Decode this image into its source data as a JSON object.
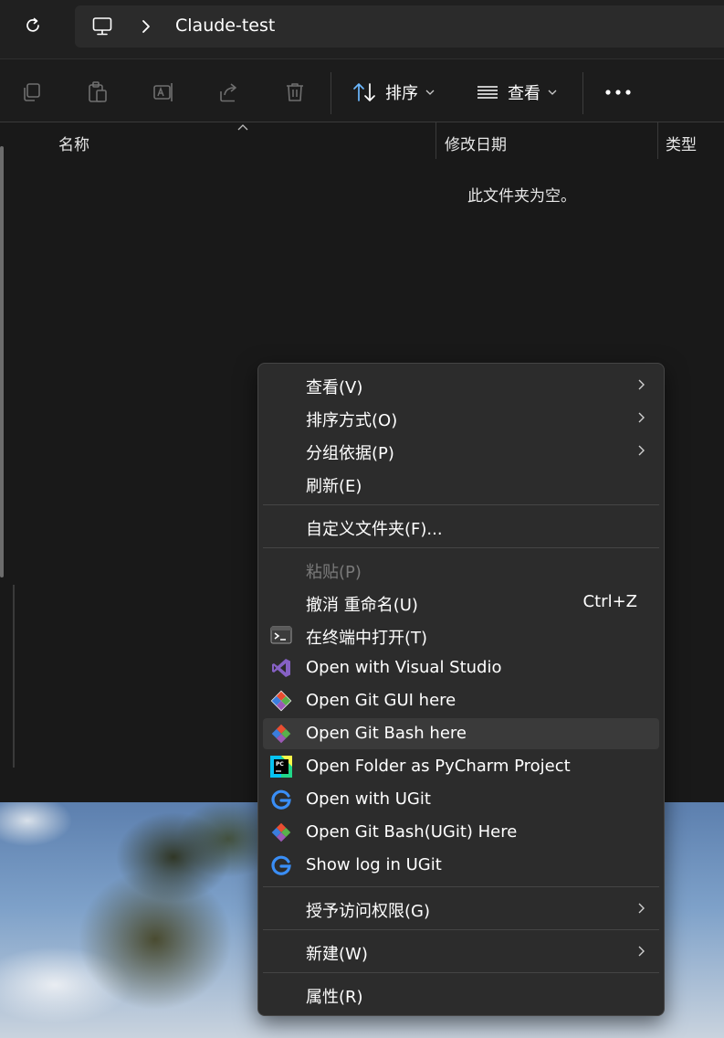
{
  "address_bar": {
    "path": "Claude-test",
    "icons": [
      "refresh-icon",
      "this-pc-icon",
      "chevron-right-icon"
    ]
  },
  "command_bar": {
    "sort_label": "排序",
    "view_label": "查看",
    "icons": [
      "copy-icon",
      "paste-icon",
      "rename-icon",
      "share-icon",
      "delete-icon",
      "sort-icon",
      "view-lines-icon",
      "more-icon"
    ]
  },
  "columns": {
    "name": "名称",
    "modified": "修改日期",
    "type": "类型"
  },
  "empty_message": "此文件夹为空。",
  "context_menu": {
    "items": [
      {
        "label": "查看(V)",
        "submenu": true
      },
      {
        "label": "排序方式(O)",
        "submenu": true
      },
      {
        "label": "分组依据(P)",
        "submenu": true
      },
      {
        "label": "刷新(E)"
      },
      {
        "label": "自定义文件夹(F)..."
      },
      {
        "label": "粘贴(P)",
        "disabled": true
      },
      {
        "label": "撤消 重命名(U)",
        "shortcut": "Ctrl+Z"
      },
      {
        "label": "在终端中打开(T)",
        "icon": "terminal-icon"
      },
      {
        "label": "Open with Visual Studio",
        "icon": "visual-studio-icon"
      },
      {
        "label": "Open Git GUI here",
        "icon": "git-icon"
      },
      {
        "label": "Open Git Bash here",
        "icon": "git-icon",
        "highlighted": true
      },
      {
        "label": "Open Folder as PyCharm Project",
        "icon": "pycharm-icon"
      },
      {
        "label": "Open with UGit",
        "icon": "ugit-icon"
      },
      {
        "label": "Open Git Bash(UGit) Here",
        "icon": "git-icon"
      },
      {
        "label": "Show log in UGit",
        "icon": "ugit-icon"
      },
      {
        "label": "授予访问权限(G)",
        "submenu": true
      },
      {
        "label": "新建(W)",
        "submenu": true
      },
      {
        "label": "属性(R)"
      }
    ]
  },
  "colors": {
    "background": "#191919",
    "menu_background": "#2c2c2c",
    "menu_hover": "#3a3a3a",
    "text": "#ffffff",
    "disabled_text": "#7a7a7a"
  }
}
